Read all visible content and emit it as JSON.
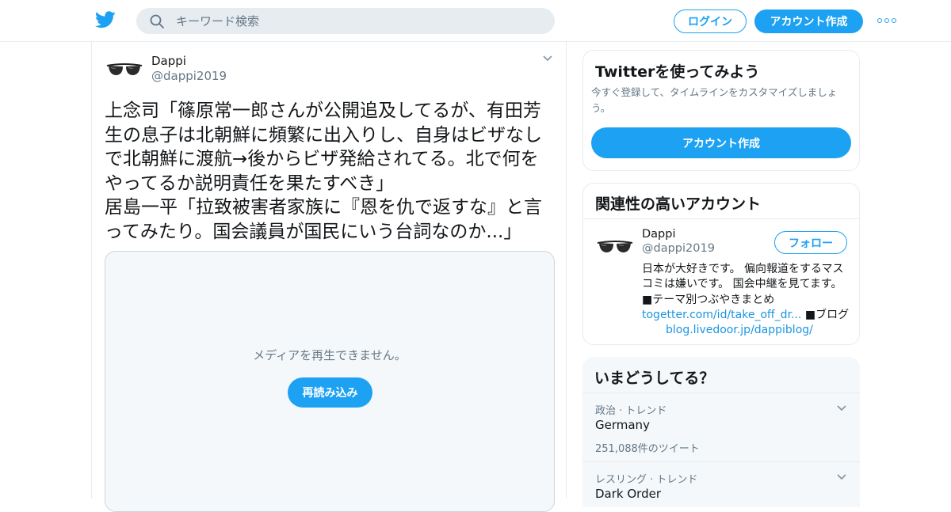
{
  "header": {
    "search_placeholder": "キーワード検索",
    "login_label": "ログイン",
    "signup_label": "アカウント作成"
  },
  "tweet": {
    "display_name": "Dappi",
    "handle": "@dappi2019",
    "text": "上念司「篠原常一郎さんが公開追及してるが、有田芳生の息子は北朝鮮に頻繁に出入りし、自身はビザなしで北朝鮮に渡航→後からビザ発給されてる。北で何をやってるか説明責任を果たすべき」\n居島一平「拉致被害者家族に『恩を仇で返すな』と言ってみたり。国会議員が国民にいう台詞なのか...」",
    "media_error": "メディアを再生できません。",
    "reload_label": "再読み込み"
  },
  "signup_card": {
    "title": "Twitterを使ってみよう",
    "subtitle": "今すぐ登録して、タイムラインをカスタマイズしましょう。",
    "button_label": "アカウント作成"
  },
  "related": {
    "title": "関連性の高いアカウント",
    "display_name": "Dappi",
    "handle": "@dappi2019",
    "follow_label": "フォロー",
    "bio_text": "日本が大好きです。 偏向報道をするマスコミは嫌いです。 国会中継を見てます。 ■テーマ別つぶやきまとめ",
    "bio_link1": "togetter.com/id/take_off_dr...",
    "bio_mid": "■ブログ",
    "bio_link2": "blog.livedoor.jp/dappiblog/"
  },
  "trends": {
    "title": "いまどうしてる？",
    "items": [
      {
        "category": "政治 · トレンド",
        "name": "Germany",
        "count": "251,088件のツイート"
      },
      {
        "category": "レスリング · トレンド",
        "name": "Dark Order",
        "count": ""
      }
    ]
  },
  "colors": {
    "brand": "#1da1f2",
    "text": "#14171a",
    "muted": "#657786",
    "border": "#e6ecf0"
  },
  "icons": [
    "twitter-bird-icon",
    "search-icon",
    "more-dots-icon",
    "chevron-down-icon"
  ]
}
